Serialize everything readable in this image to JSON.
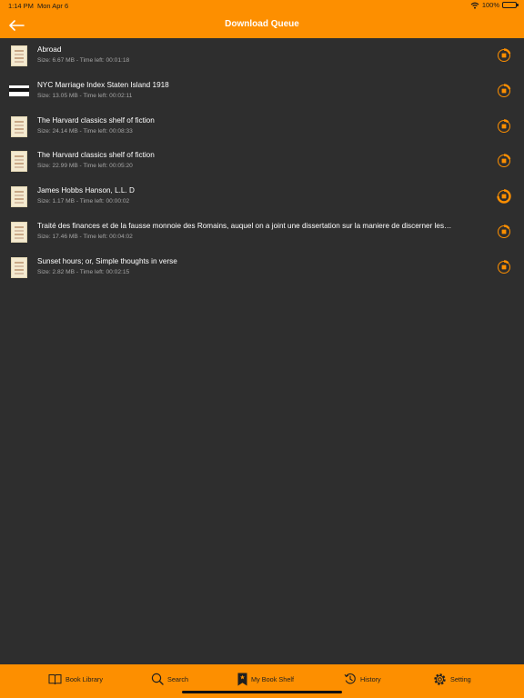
{
  "status_bar": {
    "time": "1:14 PM",
    "date": "Mon Apr 6",
    "battery": "100%"
  },
  "header": {
    "title": "Download Queue"
  },
  "colors": {
    "accent": "#fd8f00",
    "background": "#2e2e2e",
    "meta_text": "#a5a5a5"
  },
  "downloads": [
    {
      "title": "Abroad",
      "meta": "Size: 6.67 MB - Time left: 00:01:18"
    },
    {
      "title": "NYC Marriage Index   Staten Island 1918",
      "meta": "Size: 13.05 MB - Time left: 00:02:11"
    },
    {
      "title": "The Harvard classics shelf of fiction",
      "meta": "Size: 24.14 MB - Time left: 00:08:33"
    },
    {
      "title": "The Harvard classics shelf of fiction",
      "meta": "Size: 22.99 MB - Time left: 00:05:20"
    },
    {
      "title": "James Hobbs Hanson, L.L. D",
      "meta": "Size: 1.17 MB - Time left: 00:00:02"
    },
    {
      "title": "Traité des finances et de la fausse monnoie des Romains, auquel on a joint une dissertation sur la maniere de discerner les…",
      "meta": "Size: 17.46 MB - Time left: 00:04:02"
    },
    {
      "title": "Sunset hours; or, Simple thoughts in verse",
      "meta": "Size: 2.82 MB - Time left: 00:02:15"
    }
  ],
  "progress": [
    0.2,
    0.2,
    0.12,
    0.2,
    0.75,
    0.15,
    0.12
  ],
  "tabs": [
    {
      "label": "Book Library",
      "icon": "book-icon"
    },
    {
      "label": "Search",
      "icon": "search-icon"
    },
    {
      "label": "My Book Shelf",
      "icon": "bookmark-icon"
    },
    {
      "label": "History",
      "icon": "history-icon"
    },
    {
      "label": "Setting",
      "icon": "gear-icon"
    }
  ]
}
